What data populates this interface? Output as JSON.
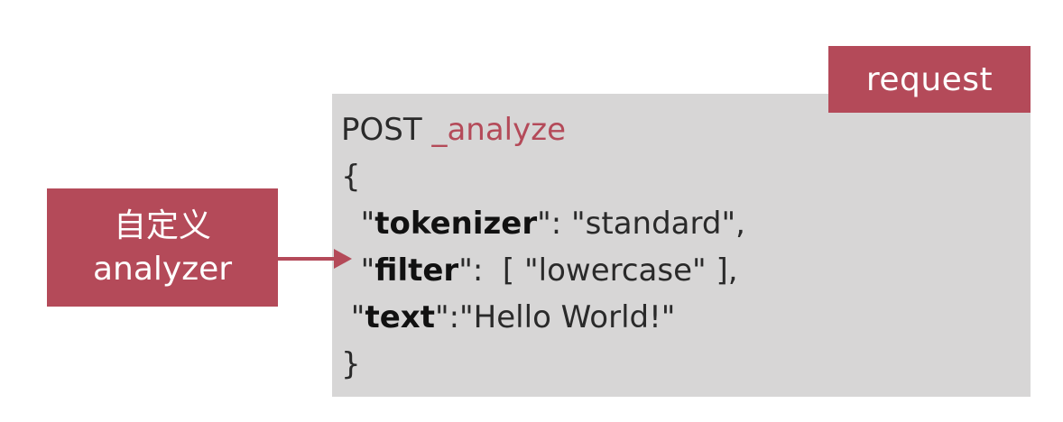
{
  "request_badge": "request",
  "label": {
    "line1": "自定义",
    "line2": "analyzer"
  },
  "code": {
    "method": "POST",
    "endpoint": "_analyze",
    "open_brace": "{",
    "tokenizer_key": "tokenizer",
    "tokenizer_value": "\"standard\",",
    "filter_key": "filter",
    "filter_value": "[ \"lowercase\" ],",
    "text_key": "text",
    "text_value": "\"Hello World!\"",
    "close_brace": "}"
  },
  "colors": {
    "accent": "#b44a59",
    "panel": "#d7d6d6"
  }
}
